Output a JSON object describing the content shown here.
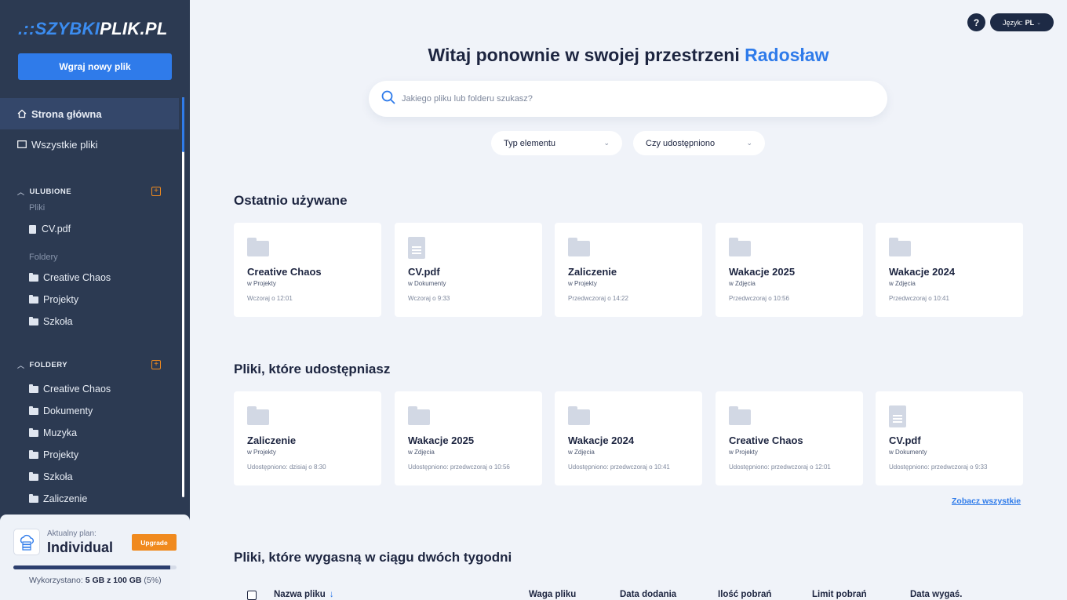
{
  "logo": {
    "prefix": "SZYBKI",
    "suffix": "PLIK.PL"
  },
  "sidebar": {
    "upload_label": "Wgraj nowy plik",
    "nav": [
      {
        "label": "Strona główna",
        "icon": "home-icon"
      },
      {
        "label": "Wszystkie pliki",
        "icon": "folder-outline-icon"
      }
    ],
    "favorites": {
      "heading": "ULUBIONE",
      "files_label": "Pliki",
      "files": [
        "CV.pdf"
      ],
      "folders_label": "Foldery",
      "folders": [
        "Creative Chaos",
        "Projekty",
        "Szkoła"
      ]
    },
    "folders": {
      "heading": "FOLDERY",
      "items": [
        "Creative Chaos",
        "Dokumenty",
        "Muzyka",
        "Projekty",
        "Szkoła",
        "Zaliczenie"
      ]
    },
    "plan": {
      "small_label": "Aktualny plan:",
      "name": "Individual",
      "upgrade_label": "Upgrade",
      "usage_prefix": "Wykorzystano:",
      "usage_value": "5 GB z 100 GB",
      "usage_percent": "(5%)",
      "usage_fraction": 0.05
    }
  },
  "topbar": {
    "help": "?",
    "lang_label": "Język:",
    "lang_value": "PL"
  },
  "header": {
    "welcome": "Witaj ponownie w swojej przestrzeni",
    "user": "Radosław"
  },
  "search": {
    "placeholder": "Jakiego pliku lub folderu szukasz?"
  },
  "filters": [
    {
      "label": "Typ elementu"
    },
    {
      "label": "Czy udostępniono"
    }
  ],
  "recent": {
    "title": "Ostatnio używane",
    "cards": [
      {
        "type": "folder",
        "name": "Creative Chaos",
        "loc": "w Projekty",
        "time": "Wczoraj o 12:01"
      },
      {
        "type": "doc",
        "name": "CV.pdf",
        "loc": "w Dokumenty",
        "time": "Wczoraj o 9:33"
      },
      {
        "type": "folder",
        "name": "Zaliczenie",
        "loc": "w Projekty",
        "time": "Przedwczoraj o 14:22"
      },
      {
        "type": "folder",
        "name": "Wakacje 2025",
        "loc": "w Zdjęcia",
        "time": "Przedwczoraj o 10:56"
      },
      {
        "type": "folder",
        "name": "Wakacje 2024",
        "loc": "w Zdjęcia",
        "time": "Przedwczoraj o 10:41"
      }
    ]
  },
  "shared": {
    "title": "Pliki, które udostępniasz",
    "cards": [
      {
        "type": "folder",
        "name": "Zaliczenie",
        "loc": "w Projekty",
        "time": "Udostępniono: dzisiaj o 8:30"
      },
      {
        "type": "folder",
        "name": "Wakacje 2025",
        "loc": "w Zdjęcia",
        "time": "Udostępniono: przedwczoraj o 10:56"
      },
      {
        "type": "folder",
        "name": "Wakacje 2024",
        "loc": "w Zdjęcia",
        "time": "Udostępniono: przedwczoraj o 10:41"
      },
      {
        "type": "folder",
        "name": "Creative Chaos",
        "loc": "w Projekty",
        "time": "Udostępniono: przedwczoraj o 12:01"
      },
      {
        "type": "doc",
        "name": "CV.pdf",
        "loc": "w Dokumenty",
        "time": "Udostępniono: przedwczoraj o 9:33"
      }
    ],
    "see_all": "Zobacz wszystkie"
  },
  "expiring": {
    "title": "Pliki, które wygasną w ciągu dwóch tygodni",
    "columns": [
      "Nazwa pliku",
      "Waga pliku",
      "Data dodania",
      "Ilość pobrań",
      "Limit pobrań",
      "Data wygaś."
    ]
  },
  "colors": {
    "sidebar": "#2c3a52",
    "accent": "#2f7bea",
    "upgrade": "#f08a1e",
    "background": "#f0f3f9"
  }
}
